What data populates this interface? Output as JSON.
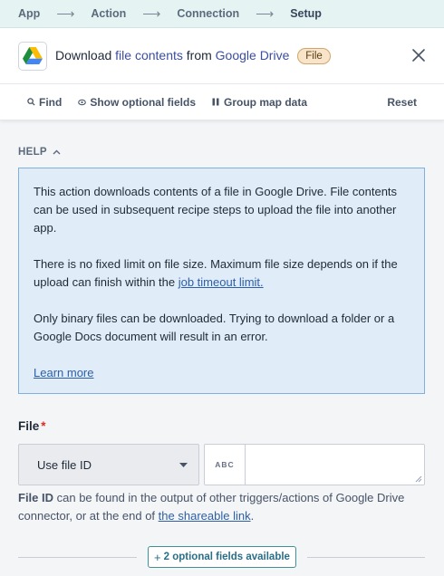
{
  "breadcrumb": {
    "steps": [
      "App",
      "Action",
      "Connection",
      "Setup"
    ],
    "arrow": "⟶"
  },
  "header": {
    "app_icon": "google-drive-icon",
    "title_prefix": "Download ",
    "title_object": "file contents",
    "title_mid": " from ",
    "title_app": "Google Drive",
    "badge": "File",
    "close_icon": "close-icon"
  },
  "toolbar": {
    "find": "Find",
    "show_optional": "Show optional fields",
    "group_map": "Group map data",
    "reset": "Reset"
  },
  "help": {
    "heading": "HELP",
    "p1": "This action downloads contents of a file in Google Drive. File contents can be used in subsequent recipe steps to upload the file into another app.",
    "p2_text": "There is no fixed limit on file size. Maximum file size depends on if the upload can finish within the ",
    "p2_link": "job timeout limit.",
    "p3": "Only binary files can be downloaded. Trying to download a folder or a Google Docs document will result in an error.",
    "learn_more": "Learn more"
  },
  "file_field": {
    "label": "File",
    "required_mark": "*",
    "mode_selected": "Use file ID",
    "type_tag": "ABC",
    "value": "",
    "hint_bold": "File ID",
    "hint_text": " can be found in the output of other triggers/actions of Google Drive connector, or at the end of ",
    "hint_link": "the shareable link",
    "hint_end": "."
  },
  "optional": {
    "plus": "+",
    "label": "2 optional fields available"
  },
  "colors": {
    "accent": "#2a6f88",
    "link": "#2e5fa6",
    "help_bg": "#e0edf9",
    "help_border": "#7fb0df",
    "badge_bg": "#f7e4c9",
    "required": "#d92d20"
  }
}
